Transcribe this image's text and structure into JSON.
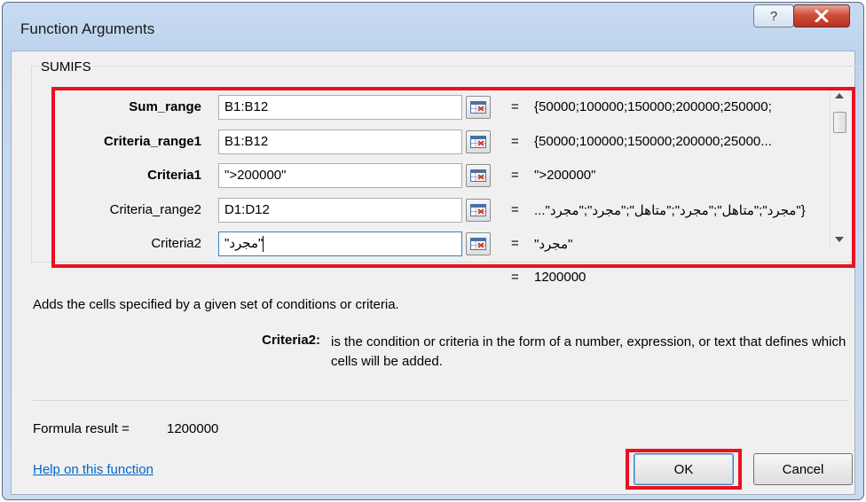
{
  "window": {
    "title": "Function Arguments",
    "help_button_label": "?"
  },
  "group": {
    "label": "SUMIFS"
  },
  "arguments": [
    {
      "label": "Sum_range",
      "value": "B1:B12",
      "result": "{50000;100000;150000;200000;250000;"
    },
    {
      "label": "Criteria_range1",
      "value": "B1:B12",
      "result": "{50000;100000;150000;200000;25000..."
    },
    {
      "label": "Criteria1",
      "value": "\">200000\"",
      "result": "\">200000\""
    },
    {
      "label": "Criteria_range2",
      "value": "D1:D12",
      "result": "{\"مجرد\";\"متاهل\";\"مجرد\";\"متاهل\";\"مجرد\";\"مجرد\"..."
    },
    {
      "label": "Criteria2",
      "value": "\"مجرد\"",
      "result": "\"مجرد\""
    }
  ],
  "equals_sign": "=",
  "function_result": "1200000",
  "description": "Adds the cells specified by a given set of conditions or criteria.",
  "arg_help": {
    "name": "Criteria2:",
    "text": "is the condition or criteria in the form of a number, expression, or text that defines which cells will be added."
  },
  "formula_result": {
    "label": "Formula result =",
    "value": "1200000"
  },
  "help_link": "Help on this function",
  "buttons": {
    "ok": "OK",
    "cancel": "Cancel"
  },
  "colors": {
    "highlight": "#e81123",
    "link": "#0066cc",
    "close_button": "#c94431"
  }
}
